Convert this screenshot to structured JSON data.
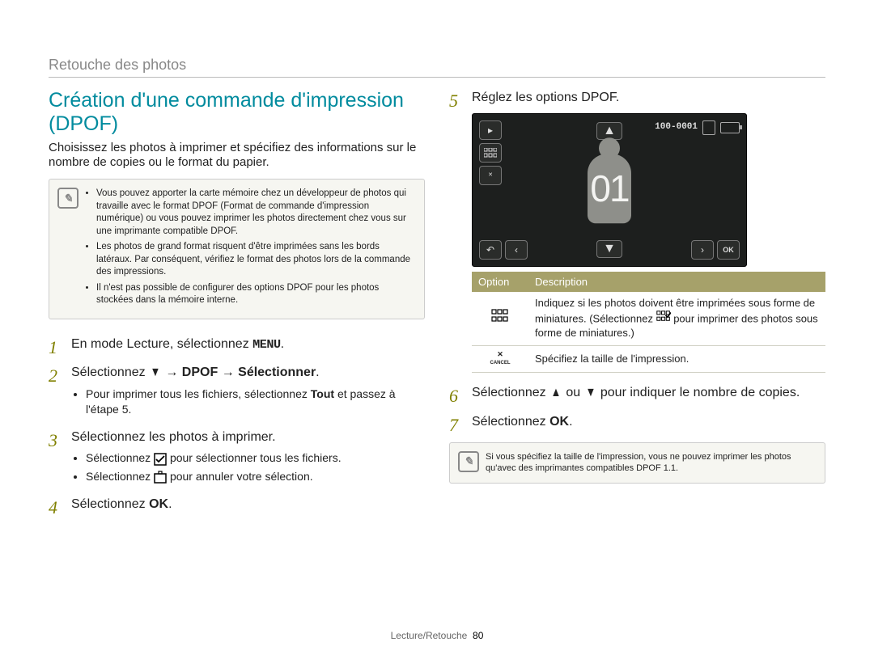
{
  "page_header": "Retouche des photos",
  "title": "Création d'une commande d'impression (DPOF)",
  "intro": "Choisissez les photos à imprimer et spécifiez des informations sur le nombre de copies ou le format du papier.",
  "noteA": {
    "bullets": [
      "Vous pouvez apporter la carte mémoire chez un développeur de photos qui travaille avec le format DPOF (Format de commande d'impression numérique) ou vous pouvez imprimer les photos directement chez vous sur une imprimante compatible DPOF.",
      "Les photos de grand format risquent d'être imprimées sans les bords latéraux. Par conséquent, vérifiez le format des photos lors de la commande des impressions.",
      "Il n'est pas possible de configurer des options DPOF pour les photos stockées dans la mémoire interne."
    ]
  },
  "steps_left": [
    {
      "text_pre": "En mode Lecture, sélectionnez ",
      "icon": "MENU",
      "text_post": "."
    },
    {
      "flow": [
        {
          "t": "Sélectionnez "
        },
        {
          "icon": "chev-down"
        },
        {
          "t": " → "
        },
        {
          "b": "DPOF"
        },
        {
          "t": " → "
        },
        {
          "b": "Sélectionner"
        },
        {
          "t": "."
        }
      ],
      "subs": [
        {
          "pre": "Pour imprimer tous les fichiers, sélectionnez ",
          "b": "Tout",
          "post": " et passez à l'étape 5."
        }
      ]
    },
    {
      "text": "Sélectionnez les photos à imprimer.",
      "subs": [
        {
          "flow": [
            {
              "t": "Sélectionnez "
            },
            {
              "icon": "select-all"
            },
            {
              "t": " pour sélectionner tous les fichiers."
            }
          ]
        },
        {
          "flow": [
            {
              "t": "Sélectionnez "
            },
            {
              "icon": "deselect"
            },
            {
              "t": " pour annuler votre sélection."
            }
          ]
        }
      ]
    },
    {
      "flow": [
        {
          "t": "Sélectionnez "
        },
        {
          "icon": "OK"
        },
        {
          "t": "."
        }
      ]
    }
  ],
  "steps_right": [
    {
      "text": "Réglez les options DPOF."
    },
    {
      "flow": [
        {
          "t": "Sélectionnez "
        },
        {
          "icon": "chev-up"
        },
        {
          "t": " ou "
        },
        {
          "icon": "chev-down"
        },
        {
          "t": " pour indiquer le nombre de copies."
        }
      ]
    },
    {
      "flow": [
        {
          "t": "Sélectionnez "
        },
        {
          "icon": "OK"
        },
        {
          "t": "."
        }
      ]
    }
  ],
  "camera": {
    "counter": "01",
    "file_label": "100-0001"
  },
  "opts_table": {
    "headers": [
      "Option",
      "Description"
    ],
    "rows": [
      {
        "icon": "grid",
        "desc_pre": "Indiquez si les photos doivent être imprimées sous forme de miniatures. (Sélectionnez ",
        "desc_post": " pour imprimer des photos sous forme de miniatures.)"
      },
      {
        "icon": "cancel",
        "desc": "Spécifiez la taille de l'impression."
      }
    ]
  },
  "noteB": "Si vous spécifiez la taille de l'impression, vous ne pouvez imprimer les photos qu'avec des imprimantes compatibles DPOF 1.1.",
  "footer": {
    "section": "Lecture/Retouche",
    "page": "80"
  }
}
